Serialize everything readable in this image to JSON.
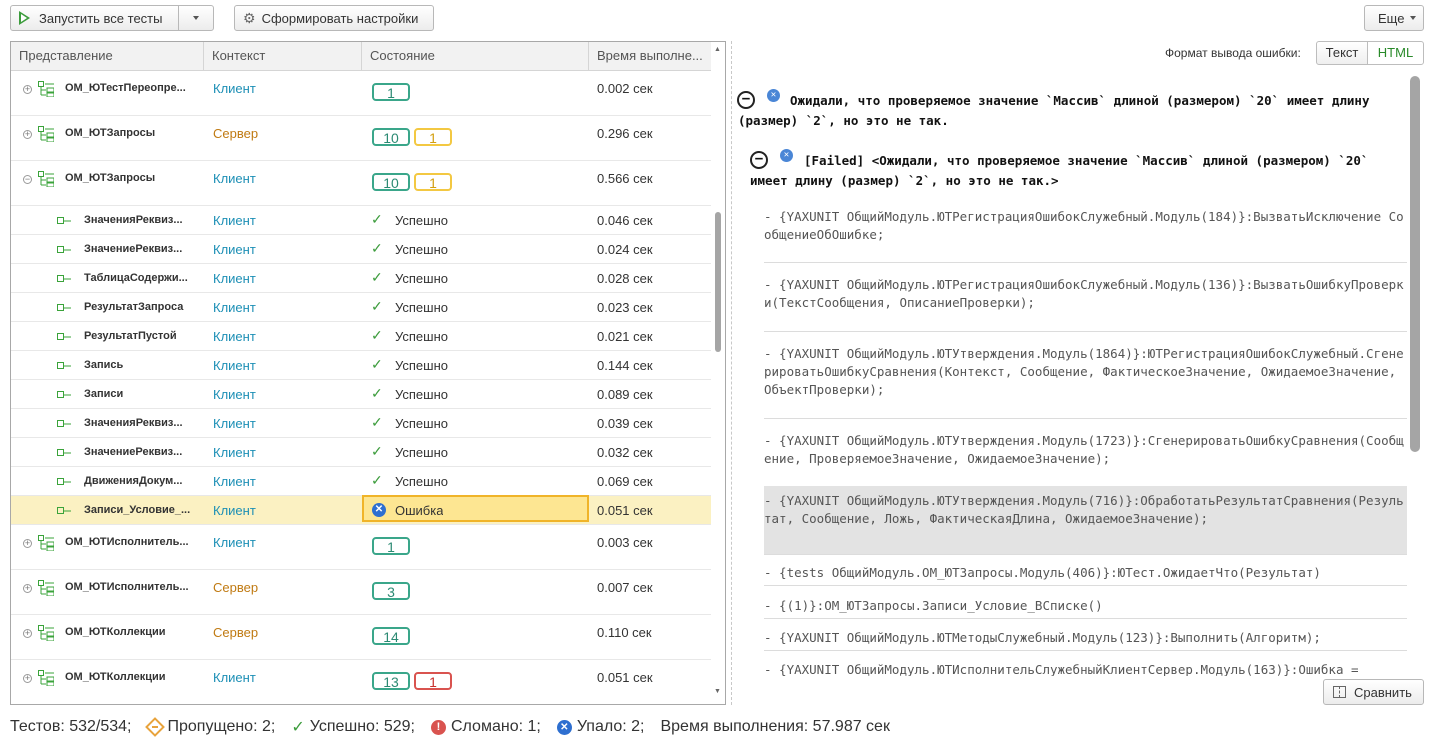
{
  "toolbar": {
    "run_all_label": "Запустить все тесты",
    "generate_settings_label": "Сформировать настройки",
    "more_label": "Еще"
  },
  "grid": {
    "columns": [
      "Представление",
      "Контекст",
      "Состояние",
      "Время выполне..."
    ],
    "rows": [
      {
        "name": "ОМ_ЮТестПереопре...",
        "context": "Клиент",
        "ctx_kind": "client",
        "group": true,
        "expand": "+",
        "badges": [
          {
            "v": "1",
            "c": "green"
          }
        ],
        "time": "0.002 сек"
      },
      {
        "name": "ОМ_ЮТЗапросы",
        "context": "Сервер",
        "ctx_kind": "server",
        "group": true,
        "expand": "+",
        "badges": [
          {
            "v": "10",
            "c": "green"
          },
          {
            "v": "1",
            "c": "yellow"
          }
        ],
        "time": "0.296 сек"
      },
      {
        "name": "ОМ_ЮТЗапросы",
        "context": "Клиент",
        "ctx_kind": "client",
        "group": true,
        "expand": "−",
        "badges": [
          {
            "v": "10",
            "c": "green"
          },
          {
            "v": "1",
            "c": "yellow"
          }
        ],
        "time": "0.566 сек"
      },
      {
        "name": "ЗначенияРеквиз...",
        "context": "Клиент",
        "ctx_kind": "client",
        "group": false,
        "state": "Успешно",
        "time": "0.046 сек"
      },
      {
        "name": "ЗначениеРеквиз...",
        "context": "Клиент",
        "ctx_kind": "client",
        "group": false,
        "state": "Успешно",
        "time": "0.024 сек"
      },
      {
        "name": "ТаблицаСодержи...",
        "context": "Клиент",
        "ctx_kind": "client",
        "group": false,
        "state": "Успешно",
        "time": "0.028 сек"
      },
      {
        "name": "РезультатЗапроса",
        "context": "Клиент",
        "ctx_kind": "client",
        "group": false,
        "state": "Успешно",
        "time": "0.023 сек"
      },
      {
        "name": "РезультатПустой",
        "context": "Клиент",
        "ctx_kind": "client",
        "group": false,
        "state": "Успешно",
        "time": "0.021 сек"
      },
      {
        "name": "Запись",
        "context": "Клиент",
        "ctx_kind": "client",
        "group": false,
        "state": "Успешно",
        "time": "0.144 сек"
      },
      {
        "name": "Записи",
        "context": "Клиент",
        "ctx_kind": "client",
        "group": false,
        "state": "Успешно",
        "time": "0.089 сек"
      },
      {
        "name": "ЗначенияРеквиз...",
        "context": "Клиент",
        "ctx_kind": "client",
        "group": false,
        "state": "Успешно",
        "time": "0.039 сек"
      },
      {
        "name": "ЗначениеРеквиз...",
        "context": "Клиент",
        "ctx_kind": "client",
        "group": false,
        "state": "Успешно",
        "time": "0.032 сек"
      },
      {
        "name": "ДвиженияДокум...",
        "context": "Клиент",
        "ctx_kind": "client",
        "group": false,
        "state": "Успешно",
        "time": "0.069 сек"
      },
      {
        "name": "Записи_Условие_...",
        "context": "Клиент",
        "ctx_kind": "client",
        "group": false,
        "state": "Ошибка",
        "error": true,
        "time": "0.051 сек"
      },
      {
        "name": "ОМ_ЮТИсполнитель...",
        "context": "Клиент",
        "ctx_kind": "client",
        "group": true,
        "expand": "+",
        "badges": [
          {
            "v": "1",
            "c": "green"
          }
        ],
        "time": "0.003 сек"
      },
      {
        "name": "ОМ_ЮТИсполнитель...",
        "context": "Сервер",
        "ctx_kind": "server",
        "group": true,
        "expand": "+",
        "badges": [
          {
            "v": "3",
            "c": "green"
          }
        ],
        "time": "0.007 сек"
      },
      {
        "name": "ОМ_ЮТКоллекции",
        "context": "Сервер",
        "ctx_kind": "server",
        "group": true,
        "expand": "+",
        "badges": [
          {
            "v": "14",
            "c": "green"
          }
        ],
        "time": "0.110 сек"
      },
      {
        "name": "ОМ_ЮТКоллекции",
        "context": "Клиент",
        "ctx_kind": "client",
        "group": true,
        "expand": "+",
        "badges": [
          {
            "v": "13",
            "c": "green"
          },
          {
            "v": "1",
            "c": "red"
          }
        ],
        "time": "0.051 сек"
      }
    ]
  },
  "error_panel": {
    "format_label": "Формат вывода ошибки:",
    "format_text": "Текст",
    "format_html": "HTML",
    "heading": "Ожидали, что проверяемое значение `Массив` длиной (размером) `20` имеет длину (размер) `2`, но это не так.",
    "sub_heading": "[Failed] <Ожидали, что проверяемое значение `Массив` длиной (размером) `20` имеет длину (размер) `2`, но это не так.>",
    "stack": [
      "- {YAXUNIT ОбщийМодуль.ЮТРегистрацияОшибокСлужебный.Модуль(184)}:ВызватьИсключение СообщениеОбОшибке;",
      "- {YAXUNIT ОбщийМодуль.ЮТРегистрацияОшибокСлужебный.Модуль(136)}:ВызватьОшибкуПроверки(ТекстСообщения, ОписаниеПроверки);",
      "- {YAXUNIT ОбщийМодуль.ЮТУтверждения.Модуль(1864)}:ЮТРегистрацияОшибокСлужебный.СгенерироватьОшибкуСравнения(Контекст, Сообщение, ФактическоеЗначение, ОжидаемоеЗначение, ОбъектПроверки);",
      "- {YAXUNIT ОбщийМодуль.ЮТУтверждения.Модуль(1723)}:СгенерироватьОшибкуСравнения(Сообщение, ПроверяемоеЗначение, ОжидаемоеЗначение);",
      "- {YAXUNIT ОбщийМодуль.ЮТУтверждения.Модуль(716)}:ОбработатьРезультатСравнения(Результат, Сообщение, Ложь, ФактическаяДлина, ОжидаемоеЗначение);",
      "- {tests ОбщийМодуль.ОМ_ЮТЗапросы.Модуль(406)}:ЮТест.ОжидаетЧто(Результат)",
      "- {(1)}:ОМ_ЮТЗапросы.Записи_Условие_ВСписке()",
      "- {YAXUNIT ОбщийМодуль.ЮТМетодыСлужебный.Модуль(123)}:Выполнить(Алгоритм);",
      "- {YAXUNIT ОбщийМодуль.ЮТИсполнительСлужебныйКлиентСервер.Модуль(163)}:Ошибка ="
    ],
    "compare_label": "Сравнить"
  },
  "status": {
    "tests": "Тестов: 532/534;",
    "skipped": "Пропущено: 2;",
    "passed": "Успешно: 529;",
    "broken": "Сломано: 1;",
    "failed": "Упало: 2;",
    "duration": "Время выполнения: 57.987 сек"
  }
}
